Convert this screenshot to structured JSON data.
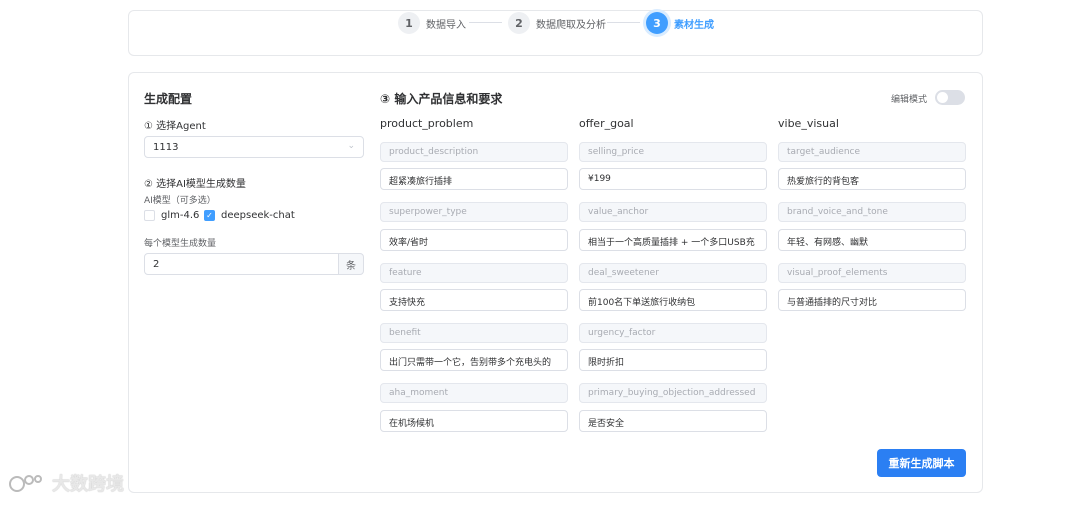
{
  "stepper": {
    "steps": [
      {
        "num": "1",
        "label": "数据导入"
      },
      {
        "num": "2",
        "label": "数据爬取及分析"
      },
      {
        "num": "3",
        "label": "素材生成"
      }
    ],
    "active_step": 3
  },
  "config": {
    "title": "生成配置",
    "agent_label": "① 选择Agent",
    "agent_value": "1113",
    "model_section_label": "② 选择AI模型生成数量",
    "model_sub_label": "AI模型（可多选）",
    "models": [
      {
        "label": "glm-4.6",
        "checked": false
      },
      {
        "label": "deepseek-chat",
        "checked": true
      }
    ],
    "count_label": "每个模型生成数量",
    "count_value": "2",
    "count_unit": "条"
  },
  "product": {
    "title": "③ 输入产品信息和要求",
    "edit_mode_label": "编辑模式",
    "edit_mode_on": false,
    "columns": [
      {
        "header": "product_problem",
        "fields": [
          {
            "key": "product_description",
            "value": "超紧凑旅行插排"
          },
          {
            "key": "superpower_type",
            "value": "效率/省时"
          },
          {
            "key": "feature",
            "value": "支持快充"
          },
          {
            "key": "benefit",
            "value": "出门只需带一个它，告别带多个充电头的"
          },
          {
            "key": "aha_moment",
            "value": "在机场候机"
          }
        ]
      },
      {
        "header": "offer_goal",
        "fields": [
          {
            "key": "selling_price",
            "value": "¥199"
          },
          {
            "key": "value_anchor",
            "value": "相当于一个高质量插排 + 一个多口USB充"
          },
          {
            "key": "deal_sweetener",
            "value": "前100名下单送旅行收纳包"
          },
          {
            "key": "urgency_factor",
            "value": "限时折扣"
          },
          {
            "key": "primary_buying_objection_addressed",
            "value": "是否安全"
          }
        ]
      },
      {
        "header": "vibe_visual",
        "fields": [
          {
            "key": "target_audience",
            "value": "热爱旅行的背包客"
          },
          {
            "key": "brand_voice_and_tone",
            "value": "年轻、有网感、幽默"
          },
          {
            "key": "visual_proof_elements",
            "value": "与普通插排的尺寸对比"
          }
        ]
      }
    ],
    "regenerate_label": "重新生成脚本"
  },
  "watermark": {
    "text": "大数跨境"
  },
  "colors": {
    "accent": "#409eff",
    "button": "#2b7ff3"
  }
}
